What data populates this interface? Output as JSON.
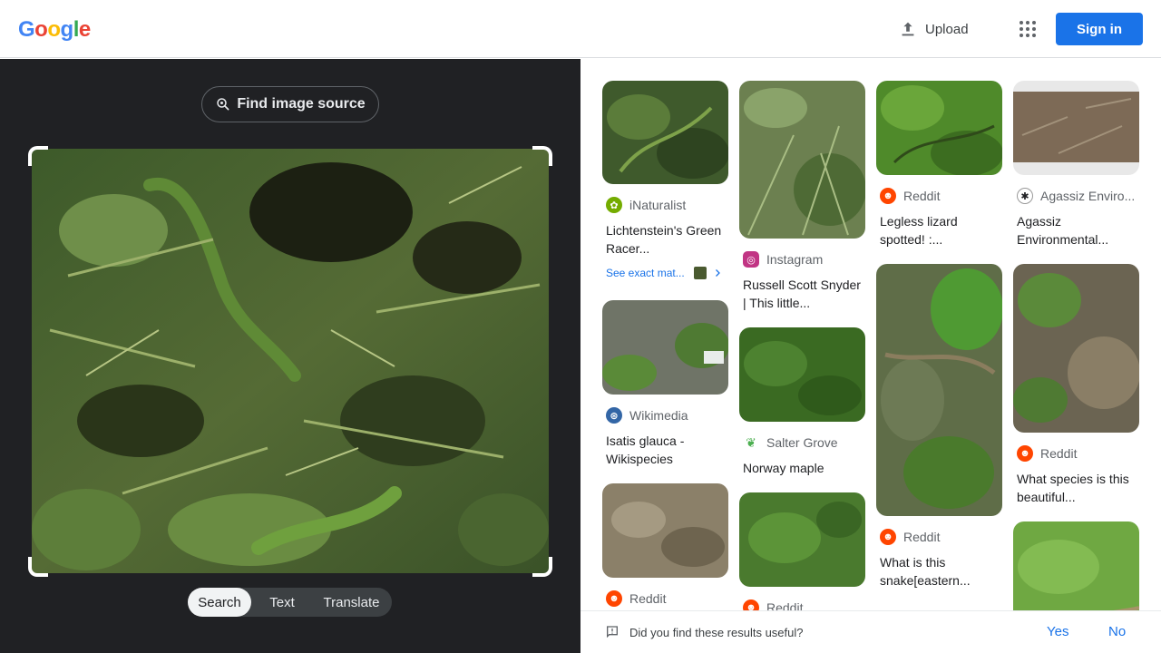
{
  "header": {
    "logo_letters": [
      {
        "ch": "G",
        "color": "#4285f4"
      },
      {
        "ch": "o",
        "color": "#ea4335"
      },
      {
        "ch": "o",
        "color": "#fbbc05"
      },
      {
        "ch": "g",
        "color": "#4285f4"
      },
      {
        "ch": "l",
        "color": "#34a853"
      },
      {
        "ch": "e",
        "color": "#ea4335"
      }
    ],
    "upload_label": "Upload",
    "apps_icon": "apps-grid-icon",
    "signin_label": "Sign in"
  },
  "query": {
    "find_source_label": "Find image source",
    "modes": [
      "Search",
      "Text",
      "Translate"
    ],
    "active_mode": "Search"
  },
  "results": {
    "col1": [
      {
        "source": "iNaturalist",
        "favicon": "inaturalist-icon",
        "title": "Lichtenstein's Green Racer...",
        "exact_label": "See exact mat..."
      },
      {
        "source": "Wikimedia",
        "favicon": "wikimedia-icon",
        "title": "Isatis glauca - Wikispecies"
      },
      {
        "source": "Reddit",
        "favicon": "reddit-icon",
        "title": ""
      }
    ],
    "col2": [
      {
        "source": "Instagram",
        "favicon": "instagram-icon",
        "title": "Russell Scott Snyder | This little..."
      },
      {
        "source": "Salter Grove",
        "favicon": "leaf-icon",
        "title": "Norway maple"
      },
      {
        "source": "Reddit",
        "favicon": "reddit-icon",
        "title": ""
      }
    ],
    "col3": [
      {
        "source": "Reddit",
        "favicon": "reddit-icon",
        "title": "Legless lizard spotted! :..."
      },
      {
        "source": "Reddit",
        "favicon": "reddit-icon",
        "title": "What is this snake[eastern..."
      }
    ],
    "col4": [
      {
        "source": "Agassiz Enviro...",
        "favicon": "agassiz-icon",
        "title": "Agassiz Environmental..."
      },
      {
        "source": "Reddit",
        "favicon": "reddit-icon",
        "title": "What species is this beautiful..."
      }
    ]
  },
  "feedback": {
    "question": "Did you find these results useful?",
    "yes": "Yes",
    "no": "No"
  }
}
